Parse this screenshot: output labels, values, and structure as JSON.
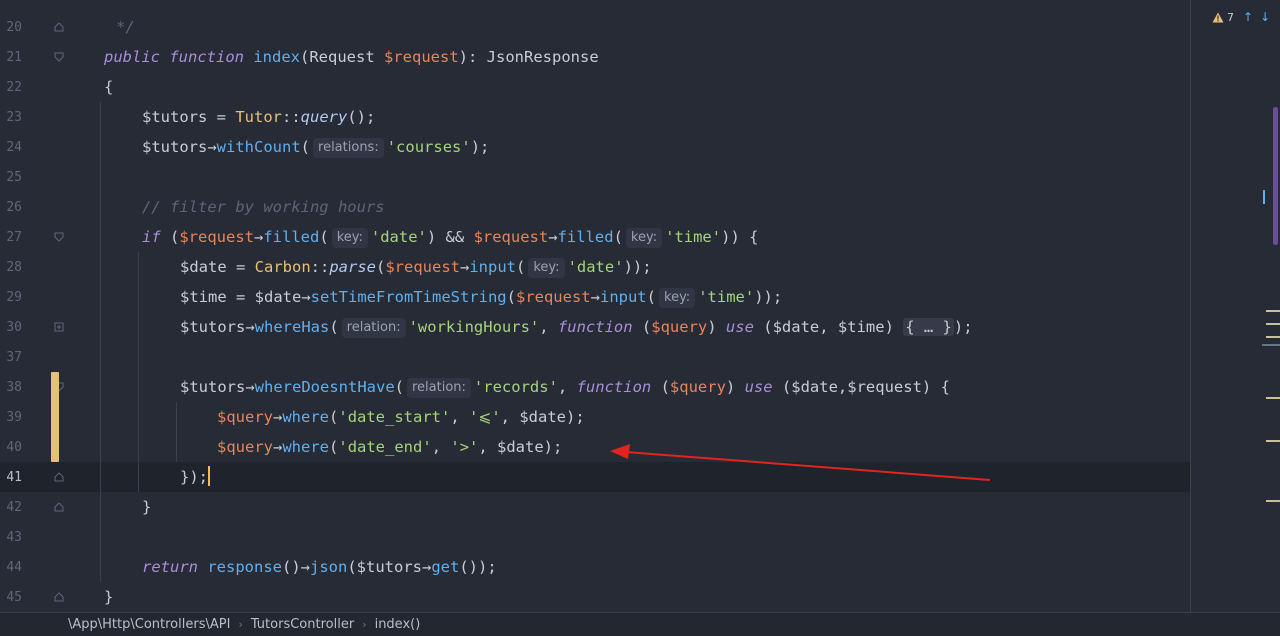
{
  "editor": {
    "inspection_count": "7",
    "line_numbers": [
      "20",
      "21",
      "22",
      "23",
      "24",
      "25",
      "26",
      "27",
      "28",
      "29",
      "30",
      "37",
      "38",
      "39",
      "40",
      "41",
      "42",
      "43",
      "44",
      "45"
    ],
    "code": {
      "l20": "*/",
      "l21": [
        "public",
        "function",
        "index",
        "(Request ",
        "$request",
        "): JsonResponse"
      ],
      "l22": "{",
      "l23": [
        "$tutors = ",
        "Tutor",
        "::",
        "query",
        "();"
      ],
      "l24": [
        "$tutors",
        "→",
        "withCount",
        "(",
        "relations:",
        "'courses'",
        ");"
      ],
      "l26": "// filter by working hours",
      "l27": [
        "if",
        " (",
        "$request",
        "→",
        "filled",
        "(",
        "key:",
        "'date'",
        ") && ",
        "$request",
        "→",
        "filled",
        "(",
        "key:",
        "'time'",
        ")) {"
      ],
      "l28": [
        "$date = ",
        "Carbon",
        "::",
        "parse",
        "(",
        "$request",
        "→",
        "input",
        "(",
        "key:",
        "'date'",
        "));"
      ],
      "l29": [
        "$time = $date",
        "→",
        "setTimeFromTimeString",
        "(",
        "$request",
        "→",
        "input",
        "(",
        "key:",
        "'time'",
        "));"
      ],
      "l30": [
        "$tutors",
        "→",
        "whereHas",
        "(",
        "relation:",
        "'workingHours'",
        ", ",
        "function",
        " (",
        "$query",
        ") ",
        "use",
        " ($date, $time) ",
        "{ … }",
        ");"
      ],
      "l38": [
        "$tutors",
        "→",
        "whereDoesntHave",
        "(",
        "relation:",
        "'records'",
        ", ",
        "function",
        " (",
        "$query",
        ") ",
        "use",
        " ($date,$request) {"
      ],
      "l39": [
        "$query",
        "→",
        "where",
        "(",
        "'date_start'",
        ", ",
        "'⩽'",
        ", $date);"
      ],
      "l40": [
        "$query",
        "→",
        "where",
        "(",
        "'date_end'",
        ", ",
        "'>'",
        ", $date);"
      ],
      "l41": "});",
      "l42": "}",
      "l44": [
        "return",
        " response",
        "()",
        "→",
        "json",
        "($tutors",
        "→",
        "get",
        "());"
      ],
      "l45": "}"
    }
  },
  "breadcrumb": [
    "\\App\\Http\\Controllers\\API",
    "TutorsController",
    "index()"
  ],
  "colors": {
    "annotation_arrow": "#e0251f",
    "change_marker": "#e5c07b",
    "scrollbar": "#6b4e9a"
  },
  "icons": [
    "warning-icon",
    "arrow-up-icon",
    "arrow-down-icon",
    "fold-icon",
    "chevron-right-icon"
  ]
}
